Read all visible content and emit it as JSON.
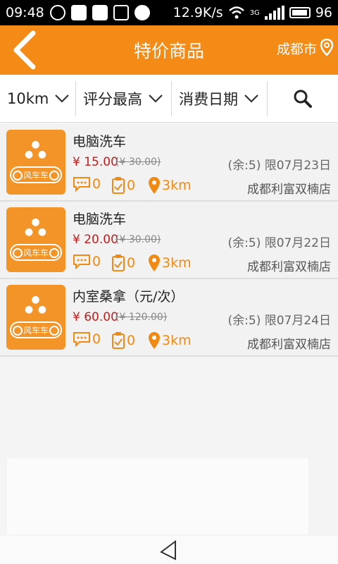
{
  "status_bar": {
    "time": "09:48",
    "speed": "12.9K/s",
    "network": "3G",
    "battery": "96"
  },
  "header": {
    "title": "特价商品",
    "city": "成都市"
  },
  "filters": {
    "distance": "10km",
    "sort": "评分最高",
    "date": "消费日期"
  },
  "items": [
    {
      "name": "电脑洗车",
      "price": "¥ 15.00",
      "old_price": "(¥ 30.00)",
      "stock": "(余:5) 限07月23日",
      "comments": "0",
      "bookings": "0",
      "distance": "3km",
      "shop": "成都利富双楠店",
      "logo_text": "风车车"
    },
    {
      "name": "电脑洗车",
      "price": "¥ 20.00",
      "old_price": "(¥ 30.00)",
      "stock": "(余:5) 限07月22日",
      "comments": "0",
      "bookings": "0",
      "distance": "3km",
      "shop": "成都利富双楠店",
      "logo_text": "风车车"
    },
    {
      "name": "内室桑拿（元/次）",
      "price": "¥ 60.00",
      "old_price": "(¥ 120.00)",
      "stock": "(余:5) 限07月24日",
      "comments": "0",
      "bookings": "0",
      "distance": "3km",
      "shop": "成都利富双楠店",
      "logo_text": "风车车"
    }
  ],
  "colors": {
    "accent": "#f38b16",
    "price": "#c21d1d"
  }
}
